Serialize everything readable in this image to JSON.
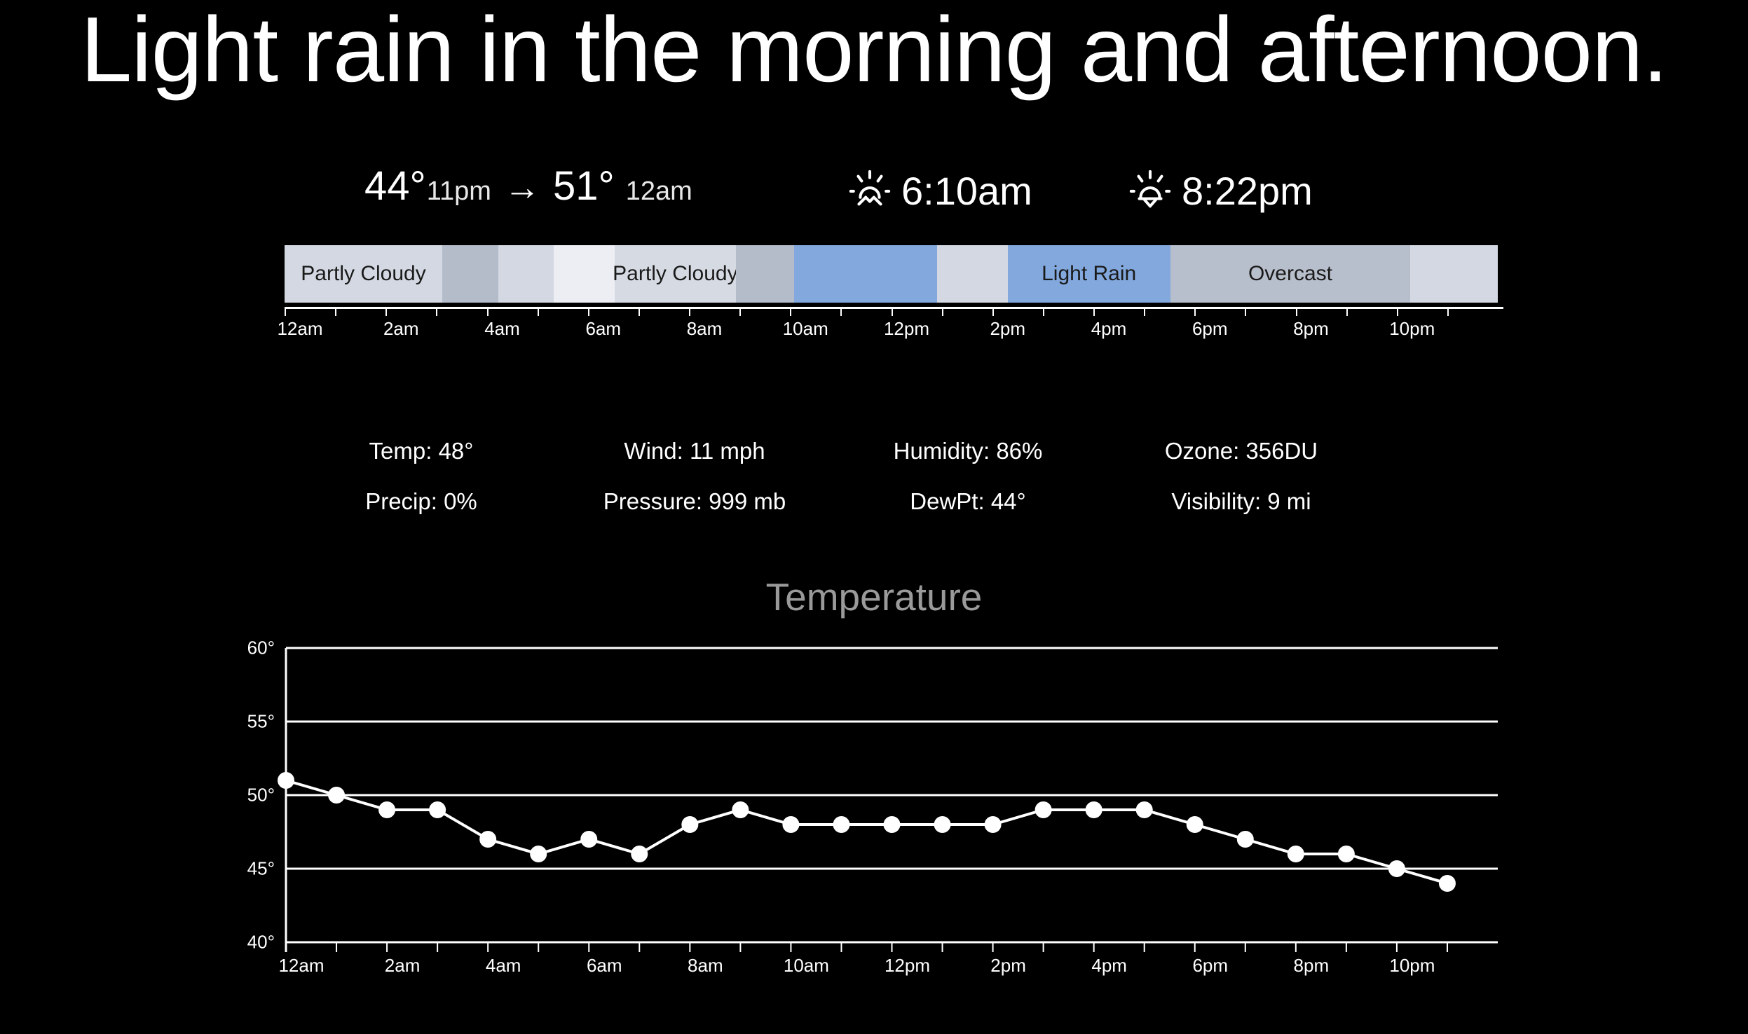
{
  "headline": "Light rain in the morning and afternoon.",
  "summary": {
    "start_temp": "44°",
    "start_time": "11pm",
    "arrow": "→",
    "end_temp": "51°",
    "end_time": "12am",
    "sunrise_time": "6:10am",
    "sunset_time": "8:22pm"
  },
  "timeline": {
    "segments": [
      {
        "label": "Partly Cloudy",
        "start": 0.0,
        "end": 0.13,
        "color": "#d3d8e2"
      },
      {
        "label": "",
        "start": 0.13,
        "end": 0.176,
        "color": "#b4bcca"
      },
      {
        "label": "",
        "start": 0.176,
        "end": 0.222,
        "color": "#d3d8e2"
      },
      {
        "label": "",
        "start": 0.222,
        "end": 0.272,
        "color": "#eceef3"
      },
      {
        "label": "Partly Cloudy",
        "start": 0.272,
        "end": 0.372,
        "color": "#d6dae3"
      },
      {
        "label": "",
        "start": 0.372,
        "end": 0.42,
        "color": "#b4bcca"
      },
      {
        "label": "",
        "start": 0.42,
        "end": 0.538,
        "color": "#82a8dd"
      },
      {
        "label": "",
        "start": 0.538,
        "end": 0.596,
        "color": "#d3d8e2"
      },
      {
        "label": "Light Rain",
        "start": 0.596,
        "end": 0.73,
        "color": "#82a8dd"
      },
      {
        "label": "Overcast",
        "start": 0.73,
        "end": 0.928,
        "color": "#b8bfcc"
      },
      {
        "label": "",
        "start": 0.928,
        "end": 1.0,
        "color": "#d3d8e2"
      }
    ],
    "tick_labels": [
      "12am",
      "2am",
      "4am",
      "6am",
      "8am",
      "10am",
      "12pm",
      "2pm",
      "4pm",
      "6pm",
      "8pm",
      "10pm"
    ],
    "tick_count": 24
  },
  "stats": {
    "row1": [
      "Temp: 48°",
      "Wind: 11 mph",
      "Humidity: 86%",
      "Ozone: 356DU"
    ],
    "row2": [
      "Precip: 0%",
      "Pressure: 999 mb",
      "DewPt: 44°",
      "Visibility: 9 mi"
    ]
  },
  "chart_data": {
    "type": "line",
    "title": "Temperature",
    "xlabel": "",
    "ylabel": "",
    "ylim": [
      40,
      60
    ],
    "ytick_labels": [
      "60°",
      "55°",
      "50°",
      "45°",
      "40°"
    ],
    "ytick_values": [
      60,
      55,
      50,
      45,
      40
    ],
    "grid": true,
    "legend": "none",
    "x": [
      "12am",
      "1am",
      "2am",
      "3am",
      "4am",
      "5am",
      "6am",
      "7am",
      "8am",
      "9am",
      "10am",
      "11am",
      "12pm",
      "1pm",
      "2pm",
      "3pm",
      "4pm",
      "5pm",
      "6pm",
      "7pm",
      "8pm",
      "9pm",
      "10pm",
      "11pm"
    ],
    "xtick_labels": [
      "12am",
      "2am",
      "4am",
      "6am",
      "8am",
      "10am",
      "12pm",
      "2pm",
      "4pm",
      "6pm",
      "8pm",
      "10pm"
    ],
    "values": [
      51,
      50,
      49,
      49,
      47,
      46,
      47,
      46,
      48,
      49,
      48,
      48,
      48,
      48,
      48,
      49,
      49,
      49,
      48,
      47,
      46,
      46,
      45,
      44
    ],
    "line_color": "#ffffff",
    "marker_color": "#ffffff"
  },
  "colors": {
    "background": "#000000",
    "text": "#ffffff",
    "rain_blue": "#82a8dd",
    "chart_title": "#9a9a9a"
  }
}
